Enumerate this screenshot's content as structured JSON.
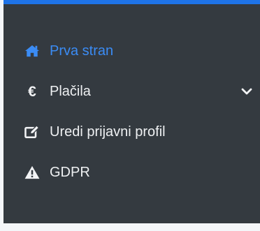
{
  "sidebar": {
    "items": [
      {
        "label": "Prva stran",
        "icon": "home-icon",
        "active": true
      },
      {
        "label": "Plačila",
        "icon": "euro-icon",
        "expandable": true,
        "expand_icon": "chevron-down-icon",
        "euro_glyph": "€"
      },
      {
        "label": "Uredi prijavni profil",
        "icon": "edit-icon"
      },
      {
        "label": "GDPR",
        "icon": "warning-icon"
      }
    ]
  },
  "colors": {
    "background": "#343a40",
    "accent": "#3b8cf5",
    "top_bar": "#1e73e8",
    "text": "#eef0f2"
  }
}
